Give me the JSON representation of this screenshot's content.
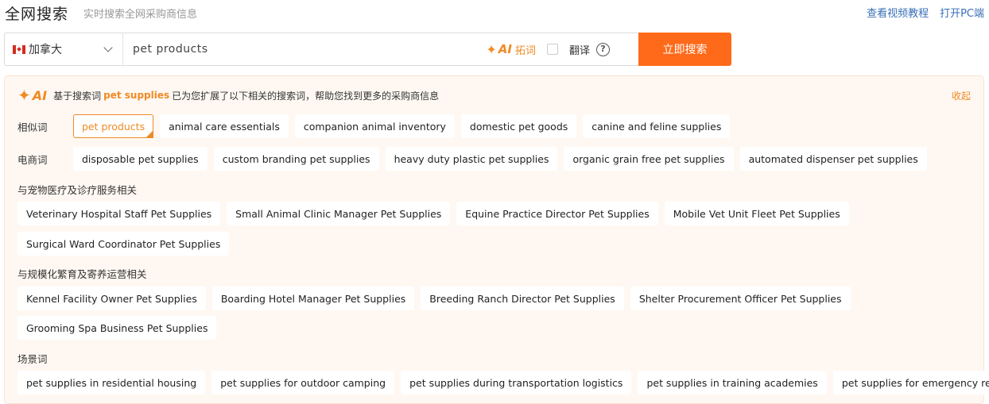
{
  "header": {
    "title": "全网搜索",
    "subtitle": "实时搜索全网采购商信息",
    "links": [
      "查看视频教程",
      "打开PC端"
    ]
  },
  "search": {
    "country": "加拿大",
    "country_flag_icon": "canada-flag-icon",
    "query": "pet products",
    "ai_badge": "AI",
    "ai_label": "拓词",
    "translate_label": "翻译",
    "translate_checked": false,
    "help_glyph": "?",
    "button_label": "立即搜索",
    "accent_color": "#ff6a1a"
  },
  "panel": {
    "ai_badge": "AI",
    "desc_prefix": "基于搜索词",
    "keyword": "pet supplies",
    "desc_suffix": "已为您扩展了以下相关的搜索词，帮助您找到更多的采购商信息",
    "collapse_label": "收起",
    "similar": {
      "label": "相似词",
      "active_index": 0,
      "items": [
        "pet products",
        "animal care essentials",
        "companion animal inventory",
        "domestic pet goods",
        "canine and feline supplies"
      ]
    },
    "ecommerce": {
      "label": "电商词",
      "items": [
        "disposable pet supplies",
        "custom branding pet supplies",
        "heavy duty plastic pet supplies",
        "organic grain free pet supplies",
        "automated dispenser pet supplies"
      ]
    },
    "medical": {
      "label": "与宠物医疗及诊疗服务相关",
      "items": [
        "Veterinary Hospital Staff Pet Supplies",
        "Small Animal Clinic Manager Pet Supplies",
        "Equine Practice Director Pet Supplies",
        "Mobile Vet Unit Fleet Pet Supplies",
        "Surgical Ward Coordinator Pet Supplies"
      ]
    },
    "breeding": {
      "label": "与规模化繁育及寄养运营相关",
      "items": [
        "Kennel Facility Owner Pet Supplies",
        "Boarding Hotel Manager Pet Supplies",
        "Breeding Ranch Director Pet Supplies",
        "Shelter Procurement Officer Pet Supplies",
        "Grooming Spa Business Pet Supplies"
      ]
    },
    "scenario": {
      "label": "场景词",
      "items": [
        "pet supplies in residential housing",
        "pet supplies for outdoor camping",
        "pet supplies during transportation logistics",
        "pet supplies in training academies",
        "pet supplies for emergency response"
      ]
    }
  }
}
